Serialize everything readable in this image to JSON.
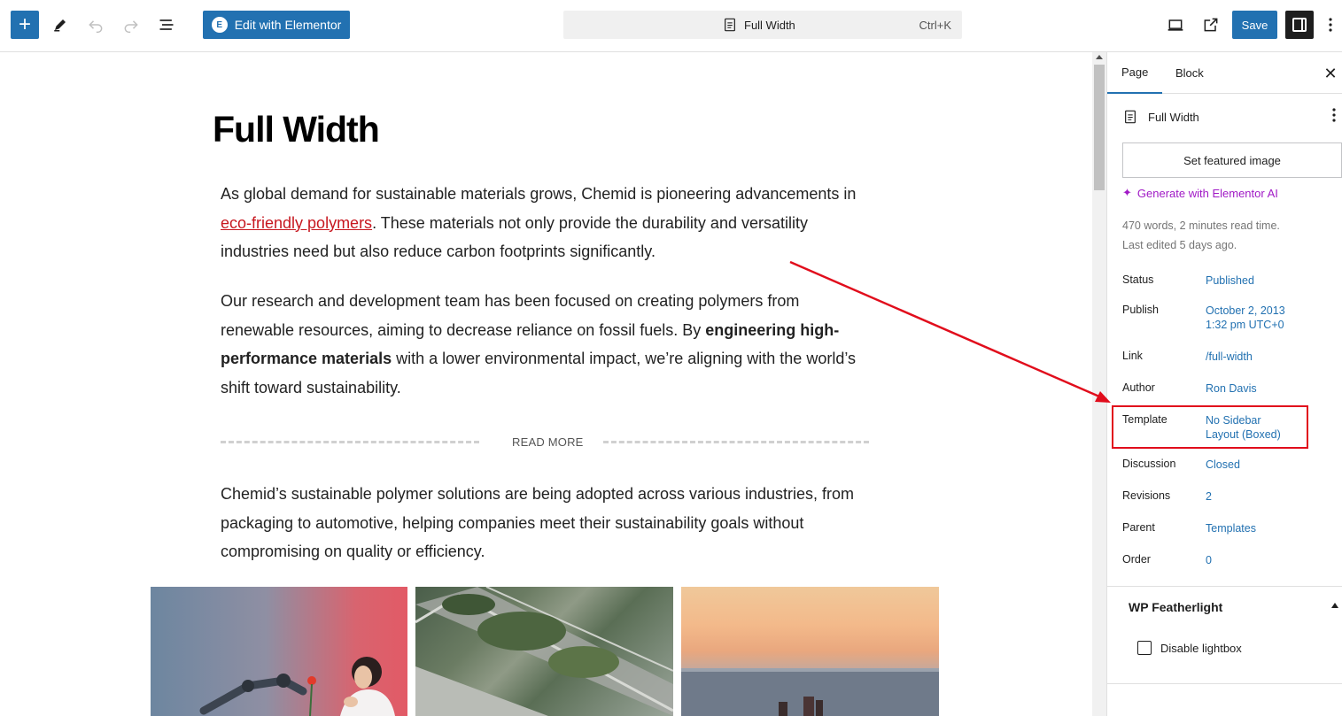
{
  "toolbar": {
    "inserter_icon": "plus-icon",
    "tools_icon": "pencil-icon",
    "undo_icon": "undo-icon",
    "redo_icon": "redo-icon",
    "outline_icon": "list-view-icon",
    "elementor_label": "Edit with Elementor",
    "elementor_logo": "E",
    "command_title": "Full Width",
    "command_shortcut": "Ctrl+K",
    "save_label": "Save"
  },
  "post": {
    "title": "Full Width",
    "p1_before": "As global demand for sustainable materials grows, Chemid is pioneering advancements in ",
    "p1_link": "eco-friendly polymers",
    "p1_after": ". These materials not only provide the durability and versatility industries need but also reduce carbon footprints significantly.",
    "p2_before": "Our research and development team has been focused on creating polymers from renewable resources, aiming to decrease reliance on fossil fuels. By ",
    "p2_bold": "engineering high-performance materials",
    "p2_after": " with a lower environmental impact, we’re aligning with the world’s shift toward sustainability.",
    "read_more": "READ MORE",
    "p3": "Chemid’s sustainable polymer solutions are being adopted across various industries, from packaging to automotive, helping companies meet their sustainability goals without compromising on quality or efficiency."
  },
  "sidebar": {
    "tab_page": "Page",
    "tab_block": "Block",
    "doc_title": "Full Width",
    "featured_image": "Set featured image",
    "ai_link": "Generate with Elementor AI",
    "meta_line1": "470 words, 2 minutes read time.",
    "meta_line2": "Last edited 5 days ago.",
    "rows": [
      {
        "key": "Status",
        "value": "Published"
      },
      {
        "key": "Publish",
        "value": "October 2, 2013",
        "value2": "1:32 pm UTC+0"
      },
      {
        "key": "Link",
        "value": "/full-width"
      },
      {
        "key": "Author",
        "value": "Ron Davis"
      },
      {
        "key": "Template",
        "value": "No Sidebar",
        "value2": "Layout (Boxed)"
      },
      {
        "key": "Discussion",
        "value": "Closed"
      },
      {
        "key": "Revisions",
        "value": "2"
      },
      {
        "key": "Parent",
        "value": "Templates"
      },
      {
        "key": "Order",
        "value": "0"
      }
    ],
    "panel_title": "WP Featherlight",
    "lightbox_label": "Disable lightbox"
  },
  "colors": {
    "accent": "#2271b1",
    "ai": "#a11ac6",
    "annotation": "#e10d1c",
    "link": "#c7171f"
  }
}
